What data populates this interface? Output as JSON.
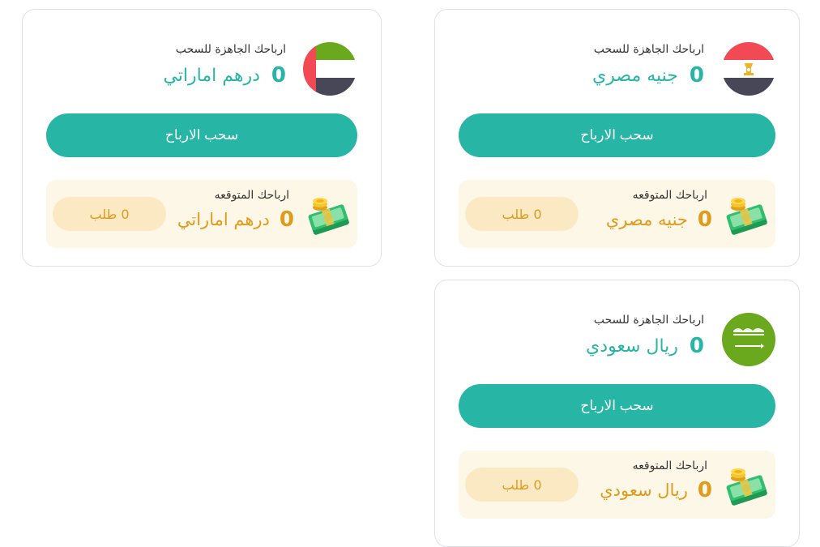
{
  "colors": {
    "accent": "#27b5a5",
    "expected_text": "#e09a1c",
    "expected_bg": "#fdf7e7",
    "pill_bg": "#fbe9c4"
  },
  "wallets": {
    "egypt": {
      "flag_icon": "egypt-flag-icon",
      "ready_label": "ارباحك الجاهزة للسحب",
      "ready_amount": "0",
      "currency": "جنيه مصري",
      "withdraw_label": "سحب الارباح",
      "expected_label": "ارباحك المتوقعه",
      "expected_amount": "0",
      "expected_currency": "جنيه مصري",
      "requests_label": "0 طلب",
      "money_icon": "money-stack-icon"
    },
    "uae": {
      "flag_icon": "uae-flag-icon",
      "ready_label": "ارباحك الجاهزة للسحب",
      "ready_amount": "0",
      "currency": "درهم اماراتي",
      "withdraw_label": "سحب الارباح",
      "expected_label": "ارباحك المتوقعه",
      "expected_amount": "0",
      "expected_currency": "درهم اماراتي",
      "requests_label": "0 طلب",
      "money_icon": "money-stack-icon"
    },
    "saudi": {
      "flag_icon": "saudi-flag-icon",
      "ready_label": "ارباحك الجاهزة للسحب",
      "ready_amount": "0",
      "currency": "ريال سعودي",
      "withdraw_label": "سحب الارباح",
      "expected_label": "ارباحك المتوقعه",
      "expected_amount": "0",
      "expected_currency": "ريال سعودي",
      "requests_label": "0 طلب",
      "money_icon": "money-stack-icon"
    }
  }
}
